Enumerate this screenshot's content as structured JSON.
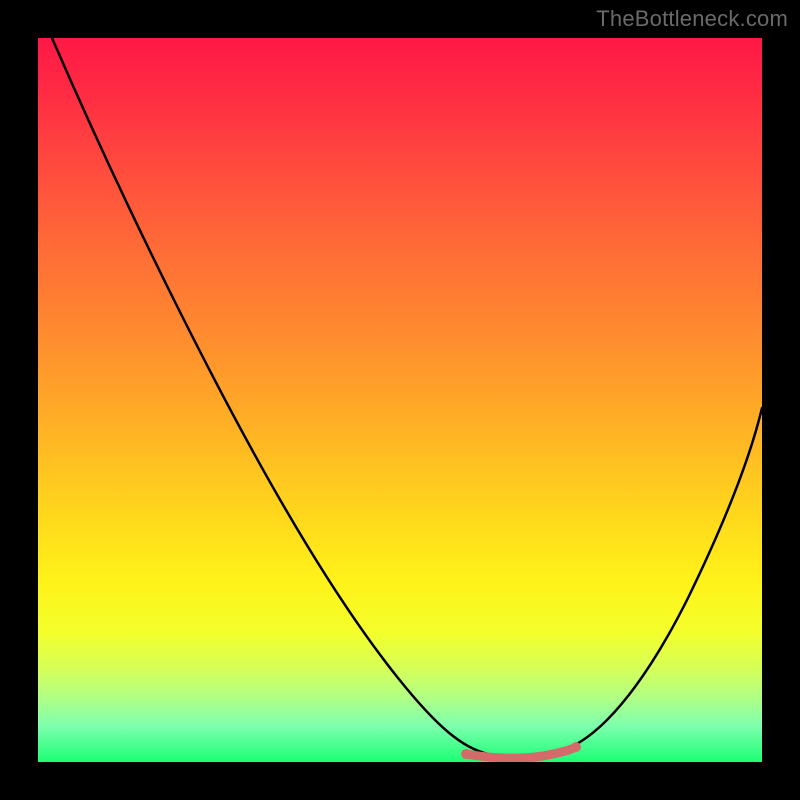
{
  "watermark": "TheBottleneck.com",
  "chart_data": {
    "type": "line",
    "title": "",
    "xlabel": "",
    "ylabel": "",
    "xlim": [
      0,
      1
    ],
    "ylim": [
      0,
      1
    ],
    "series": [
      {
        "name": "curve",
        "x": [
          0.02,
          0.06,
          0.12,
          0.2,
          0.3,
          0.4,
          0.5,
          0.56,
          0.6,
          0.64,
          0.68,
          0.72,
          0.76,
          0.82,
          0.88,
          0.94,
          1.0
        ],
        "y": [
          1.0,
          0.92,
          0.8,
          0.64,
          0.46,
          0.3,
          0.15,
          0.07,
          0.03,
          0.01,
          0.01,
          0.02,
          0.05,
          0.13,
          0.25,
          0.4,
          0.55
        ]
      }
    ],
    "annotations": [
      {
        "name": "bottom-marker",
        "x_start": 0.59,
        "x_end": 0.74,
        "y": 0.02
      }
    ],
    "background_gradient": {
      "top": "#ff1846",
      "mid": "#ffd81c",
      "bottom": "#1bff75"
    }
  }
}
